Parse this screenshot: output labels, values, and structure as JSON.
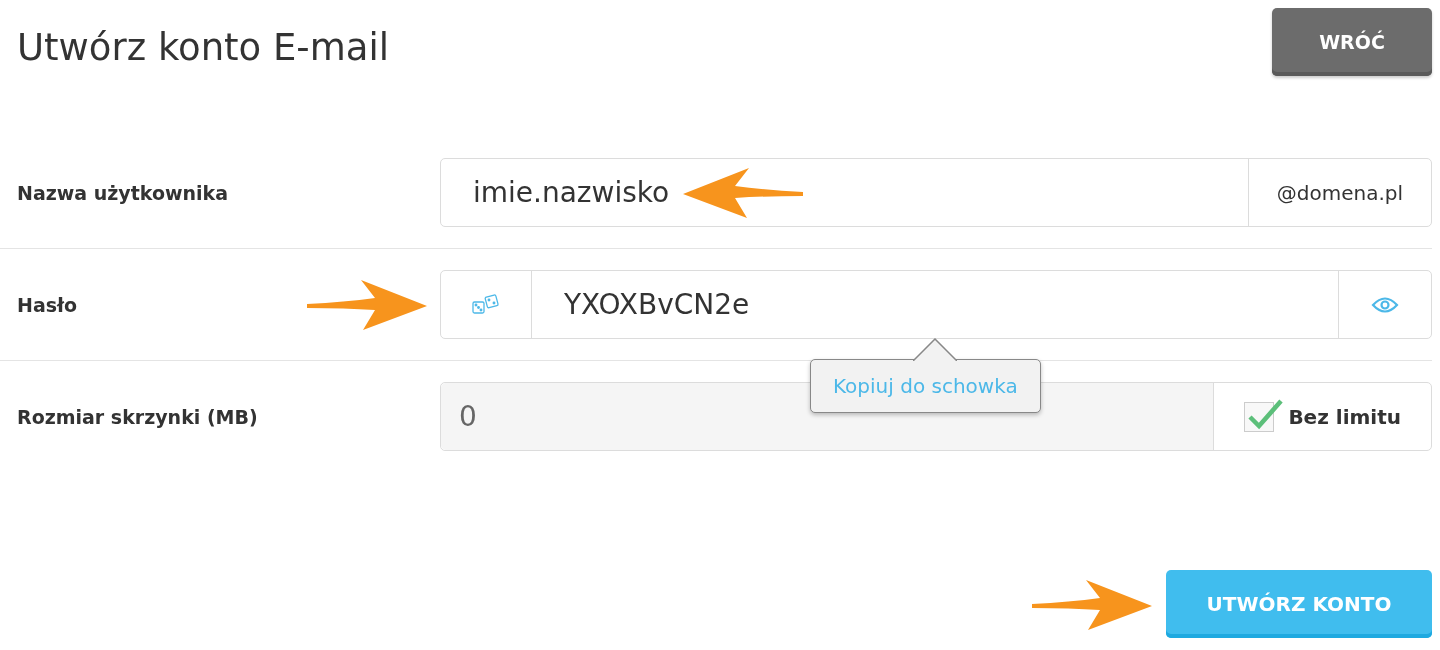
{
  "header": {
    "title": "Utwórz konto E-mail",
    "back_button": "WRÓĆ"
  },
  "fields": [
    {
      "kind": "text_suffix",
      "label": "Nazwa użytkownika",
      "value": "imie.nazwisko",
      "suffix": "@domena.pl"
    },
    {
      "kind": "password",
      "label": "Hasło",
      "value": "YXOXBvCN2e",
      "tooltip": "Kopiuj do schowka"
    },
    {
      "kind": "number_checkbox",
      "label": "Rozmiar skrzynki (MB)",
      "value": "0",
      "disabled": true,
      "checkbox_label": "Bez limitu",
      "checked": true
    }
  ],
  "submit_button": "UTWÓRZ KONTO"
}
